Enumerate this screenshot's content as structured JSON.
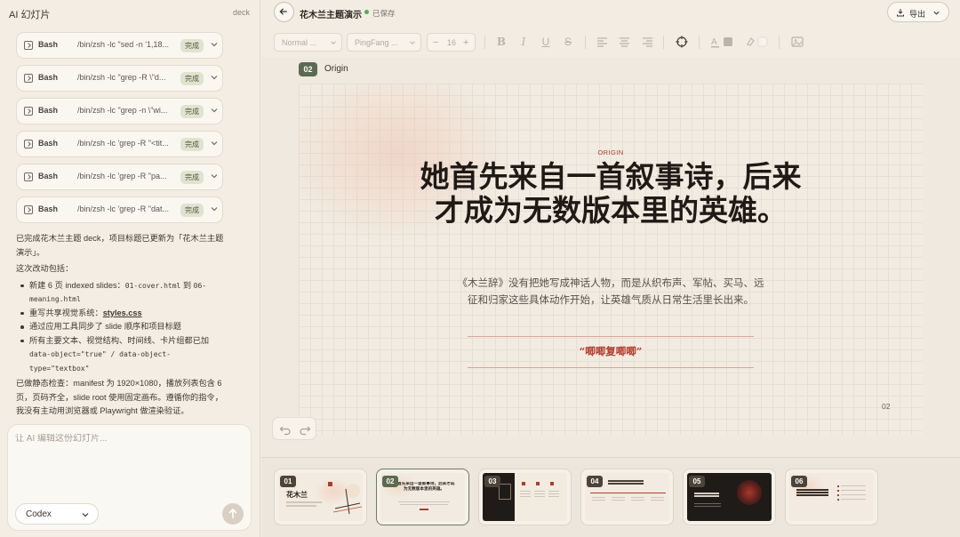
{
  "app": {
    "title": "AI 幻灯片",
    "deck_label": "deck"
  },
  "tool_calls": [
    {
      "name": "Bash",
      "command": "/bin/zsh -lc \"sed -n '1,18...",
      "status": "完成"
    },
    {
      "name": "Bash",
      "command": "/bin/zsh -lc \"grep -R \\\"d...",
      "status": "完成"
    },
    {
      "name": "Bash",
      "command": "/bin/zsh -lc \"grep -n \\\"wi...",
      "status": "完成"
    },
    {
      "name": "Bash",
      "command": "/bin/zsh -lc 'grep -R \"<tit...",
      "status": "完成"
    },
    {
      "name": "Bash",
      "command": "/bin/zsh -lc 'grep -R \"pa...",
      "status": "完成"
    },
    {
      "name": "Bash",
      "command": "/bin/zsh -lc 'grep -R \"dat...",
      "status": "完成"
    }
  ],
  "chat": {
    "intro": "已完成花木兰主题 deck，项目标题已更新为「花木兰主题演示」。",
    "changes_heading": "这次改动包括：",
    "b1_a": "新建 6 页 indexed slides：",
    "b1_code1": "01-cover.html",
    "b1_b": " 到 ",
    "b1_code2": "06-meaning.html",
    "b2_a": "重写共享视觉系统：",
    "b2_link": "styles.css",
    "b3": "通过应用工具同步了 slide 顺序和项目标题",
    "b4_a": "所有主要文本、视觉结构、时间线、卡片组都已加",
    "b4_code1": "data-object=\"true\"",
    "b4_b": " / ",
    "b4_code2": "data-object-type=\"textbox\"",
    "outro": "已做静态检查：manifest 为 1920×1080，播放列表包含 6 页，页码齐全，slide root 使用固定画布。遵循你的指令，我没有主动用浏览器或 Playwright 做渲染验证。"
  },
  "composer": {
    "placeholder": "让 AI 编辑这份幻灯片...",
    "model": "Codex"
  },
  "topbar": {
    "title": "花木兰主题演示",
    "saved": "已保存",
    "export": "导出"
  },
  "toolbar": {
    "style": "Normal ...",
    "font": "PingFang ...",
    "size": "16"
  },
  "current_slide": {
    "number": "02",
    "name": "Origin",
    "eyebrow": "ORIGIN",
    "title": "她首先来自一首叙事诗，后来才成为无数版本里的英雄。",
    "body": "《木兰辞》没有把她写成神话人物，而是从织布声、军帖、买马、远征和归家这些具体动作开始，让英雄气质从日常生活里长出来。",
    "quote": "“唧唧复唧唧”",
    "page": "02"
  },
  "thumbnails": [
    {
      "number": "01",
      "title": "花木兰"
    },
    {
      "number": "02",
      "title": "她首先来自一首叙事诗，后来才成为无数版本里的英雄。"
    },
    {
      "number": "03",
      "title": ""
    },
    {
      "number": "04",
      "title": ""
    },
    {
      "number": "05",
      "title": ""
    },
    {
      "number": "06",
      "title": ""
    }
  ],
  "colors": {
    "accent": "#b33a2c",
    "badge": "#5c6a50",
    "status_bg": "#e1e3cf"
  }
}
